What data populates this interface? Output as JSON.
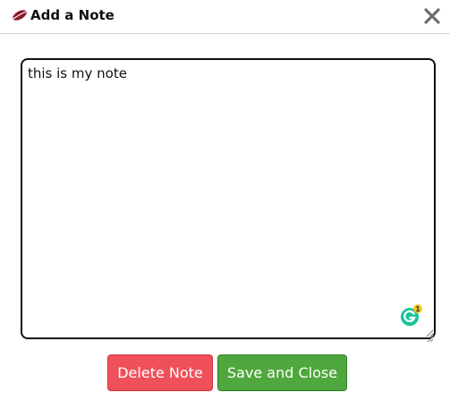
{
  "dialog": {
    "title": "Add a Note",
    "close_label": "✕"
  },
  "note": {
    "value": "this is my note",
    "grammarly_count": "1"
  },
  "actions": {
    "delete_label": "Delete Note",
    "save_label": "Save and Close"
  },
  "colors": {
    "delete": "#f0505a",
    "save": "#4fa83d",
    "grammarly": "#15c39a"
  },
  "icons": {
    "header": "note-leaf-icon",
    "close": "close-icon",
    "grammarly": "grammarly-icon",
    "resize": "resize-handle-icon"
  }
}
